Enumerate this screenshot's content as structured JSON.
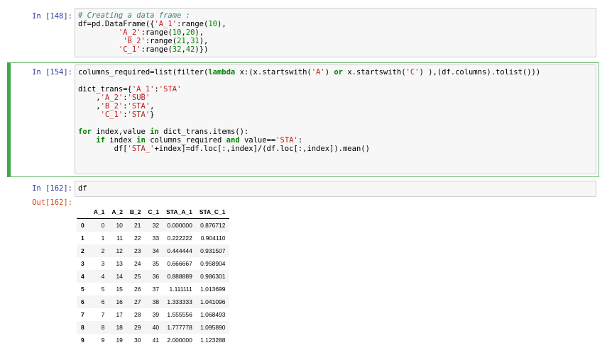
{
  "cells": {
    "c148": {
      "prompt": "In [148]:"
    },
    "c154": {
      "prompt": "In [154]:"
    },
    "c162": {
      "prompt": "In [162]:",
      "code": "df",
      "out_prompt": "Out[162]:"
    }
  },
  "dataframe": {
    "columns": [
      "",
      "A_1",
      "A_2",
      "B_2",
      "C_1",
      "STA_A_1",
      "STA_C_1"
    ],
    "rows": [
      [
        "0",
        "0",
        "10",
        "21",
        "32",
        "0.000000",
        "0.876712"
      ],
      [
        "1",
        "1",
        "11",
        "22",
        "33",
        "0.222222",
        "0.904110"
      ],
      [
        "2",
        "2",
        "12",
        "23",
        "34",
        "0.444444",
        "0.931507"
      ],
      [
        "3",
        "3",
        "13",
        "24",
        "35",
        "0.666667",
        "0.958904"
      ],
      [
        "4",
        "4",
        "14",
        "25",
        "36",
        "0.888889",
        "0.986301"
      ],
      [
        "5",
        "5",
        "15",
        "26",
        "37",
        "1.111111",
        "1.013699"
      ],
      [
        "6",
        "6",
        "16",
        "27",
        "38",
        "1.333333",
        "1.041096"
      ],
      [
        "7",
        "7",
        "17",
        "28",
        "39",
        "1.555556",
        "1.068493"
      ],
      [
        "8",
        "8",
        "18",
        "29",
        "40",
        "1.777778",
        "1.095890"
      ],
      [
        "9",
        "9",
        "19",
        "30",
        "41",
        "2.000000",
        "1.123288"
      ]
    ]
  },
  "code_lines": {
    "c148": [
      [
        [
          "cm-comment",
          "# Creating a data frame :"
        ]
      ],
      [
        [
          "",
          "df=pd.DataFrame({"
        ],
        [
          "cm-string",
          "'A_1'"
        ],
        [
          "",
          ":range("
        ],
        [
          "cm-number",
          "10"
        ],
        [
          "",
          "),"
        ]
      ],
      [
        [
          "",
          "         "
        ],
        [
          "cm-string",
          "'A_2'"
        ],
        [
          "",
          ":range("
        ],
        [
          "cm-number",
          "10"
        ],
        [
          "",
          ","
        ],
        [
          "cm-number",
          "20"
        ],
        [
          "",
          "),"
        ]
      ],
      [
        [
          "",
          "          "
        ],
        [
          "cm-string",
          "'B_2'"
        ],
        [
          "",
          ":range("
        ],
        [
          "cm-number",
          "21"
        ],
        [
          "",
          ","
        ],
        [
          "cm-number",
          "31"
        ],
        [
          "",
          "),"
        ]
      ],
      [
        [
          "",
          "         "
        ],
        [
          "cm-string",
          "'C_1'"
        ],
        [
          "",
          ":range("
        ],
        [
          "cm-number",
          "32"
        ],
        [
          "",
          ","
        ],
        [
          "cm-number",
          "42"
        ],
        [
          "",
          ")})"
        ]
      ]
    ],
    "c154": [
      [
        [
          "",
          "columns_required=list(filter("
        ],
        [
          "cm-keyword",
          "lambda"
        ],
        [
          "",
          " x:(x.startswith("
        ],
        [
          "cm-string",
          "'A'"
        ],
        [
          "",
          ") "
        ],
        [
          "cm-keyword",
          "or"
        ],
        [
          "",
          " x.startswith("
        ],
        [
          "cm-string",
          "'C'"
        ],
        [
          "",
          ") ),(df.columns).tolist()))"
        ]
      ],
      [
        [
          "",
          ""
        ]
      ],
      [
        [
          "",
          "dict_trans={"
        ],
        [
          "cm-string",
          "'A_1'"
        ],
        [
          "",
          ":"
        ],
        [
          "cm-string",
          "'STA'"
        ]
      ],
      [
        [
          "",
          "    ,"
        ],
        [
          "cm-string",
          "'A_2'"
        ],
        [
          "",
          ":"
        ],
        [
          "cm-string",
          "'SUB'"
        ]
      ],
      [
        [
          "",
          "    ,"
        ],
        [
          "cm-string",
          "'B_2'"
        ],
        [
          "",
          ":"
        ],
        [
          "cm-string",
          "'STA'"
        ],
        [
          "",
          ","
        ]
      ],
      [
        [
          "",
          "     "
        ],
        [
          "cm-string",
          "'C_1'"
        ],
        [
          "",
          ":"
        ],
        [
          "cm-string",
          "'STA'"
        ],
        [
          "",
          "}"
        ]
      ],
      [
        [
          "",
          ""
        ]
      ],
      [
        [
          "cm-keyword",
          "for"
        ],
        [
          "",
          " index,value "
        ],
        [
          "cm-keyword",
          "in"
        ],
        [
          "",
          " dict_trans.items():"
        ]
      ],
      [
        [
          "",
          "    "
        ],
        [
          "cm-keyword",
          "if"
        ],
        [
          "",
          " index "
        ],
        [
          "cm-keyword",
          "in"
        ],
        [
          "",
          " columns_required "
        ],
        [
          "cm-keyword",
          "and"
        ],
        [
          "",
          " value=="
        ],
        [
          "cm-string",
          "'STA'"
        ],
        [
          "",
          ":"
        ]
      ],
      [
        [
          "",
          "        df["
        ],
        [
          "cm-string",
          "'STA_'"
        ],
        [
          "",
          "+index]=df.loc[:,index]/(df.loc[:,index]).mean()"
        ]
      ]
    ]
  }
}
